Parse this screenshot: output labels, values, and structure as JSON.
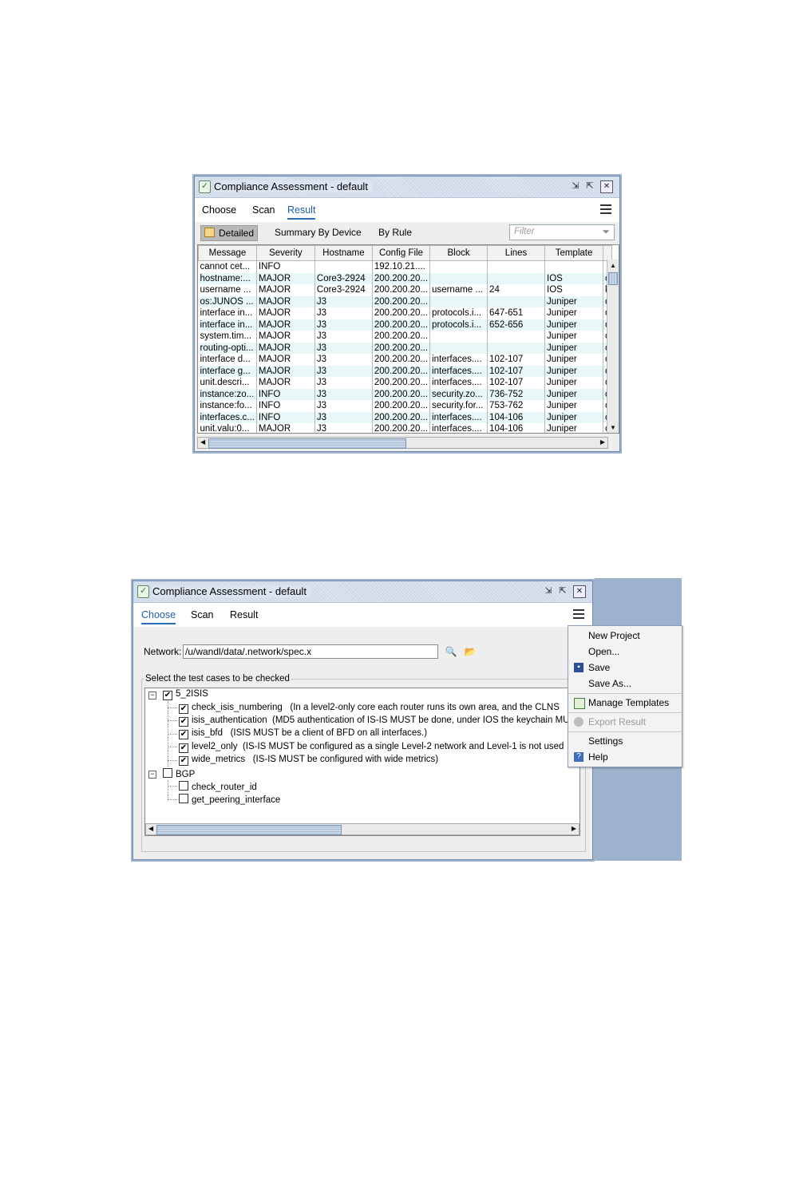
{
  "window1": {
    "title": "Compliance Assessment - default",
    "tabs": [
      "Choose",
      "Scan",
      "Result"
    ],
    "active_tab": "Result",
    "views": {
      "detailed": "Detailed",
      "by_device": "Summary By Device",
      "by_rule": "By Rule"
    },
    "filter_placeholder": "Filter",
    "columns": [
      "Message",
      "Severity",
      "Hostname",
      "Config File",
      "Block",
      "Lines",
      "Template"
    ],
    "rows": [
      [
        "cannot cet...",
        "INFO",
        "",
        "192.10.21....",
        "",
        "",
        "",
        ""
      ],
      [
        "hostname:...",
        "MAJOR",
        "Core3-2924",
        "200.200.20...",
        "",
        "",
        "IOS",
        "c"
      ],
      [
        "username ...",
        "MAJOR",
        "Core3-2924",
        "200.200.20...",
        "username ...",
        "24",
        "IOS",
        "k"
      ],
      [
        "os:JUNOS ...",
        "MAJOR",
        "J3",
        "200.200.20...",
        "",
        "",
        "Juniper",
        "c"
      ],
      [
        "interface in...",
        "MAJOR",
        "J3",
        "200.200.20...",
        "protocols.i...",
        "647-651",
        "Juniper",
        "c"
      ],
      [
        "interface in...",
        "MAJOR",
        "J3",
        "200.200.20...",
        "protocols.i...",
        "652-656",
        "Juniper",
        "c"
      ],
      [
        "system.tim...",
        "MAJOR",
        "J3",
        "200.200.20...",
        "",
        "",
        "Juniper",
        "c"
      ],
      [
        "routing-opti...",
        "MAJOR",
        "J3",
        "200.200.20...",
        "",
        "",
        "Juniper",
        "c"
      ],
      [
        "interface d...",
        "MAJOR",
        "J3",
        "200.200.20...",
        "interfaces....",
        "102-107",
        "Juniper",
        "c"
      ],
      [
        "interface g...",
        "MAJOR",
        "J3",
        "200.200.20...",
        "interfaces....",
        "102-107",
        "Juniper",
        "c"
      ],
      [
        "unit.descri...",
        "MAJOR",
        "J3",
        "200.200.20...",
        "interfaces....",
        "102-107",
        "Juniper",
        "c"
      ],
      [
        "instance:zo...",
        "INFO",
        "J3",
        "200.200.20...",
        "security.zo...",
        "736-752",
        "Juniper",
        "c"
      ],
      [
        "instance:fo...",
        "INFO",
        "J3",
        "200.200.20...",
        "security.for...",
        "753-762",
        "Juniper",
        "c"
      ],
      [
        "interfaces.c...",
        "INFO",
        "J3",
        "200.200.20...",
        "interfaces....",
        "104-106",
        "Juniper",
        "c"
      ],
      [
        "unit.valu:0...",
        "MAJOR",
        "J3",
        "200.200.20...",
        "interfaces....",
        "104-106",
        "Juniper",
        "c"
      ]
    ]
  },
  "window2": {
    "title": "Compliance Assessment - default",
    "tabs": [
      "Choose",
      "Scan",
      "Result"
    ],
    "active_tab": "Choose",
    "network_label": "Network:",
    "network_value": "/u/wandl/data/.network/spec.x",
    "group_label": "Select the test cases to be checked",
    "tree": {
      "groups": [
        {
          "label": "5_2ISIS",
          "checked": true,
          "items": [
            {
              "name": "check_isis_numbering",
              "desc": "(In a level2-only core each router runs its own area, and the CLNS",
              "checked": true
            },
            {
              "name": "isis_authentication",
              "desc": "(MD5 authentication of IS-IS MUST be done, under IOS the keychain MU",
              "checked": true
            },
            {
              "name": "isis_bfd",
              "desc": "(ISIS MUST be a client of BFD on all interfaces.)",
              "checked": true
            },
            {
              "name": "level2_only",
              "desc": "(IS-IS MUST be configured as a single Level-2 network and Level-1 is not used",
              "checked": true
            },
            {
              "name": "wide_metrics",
              "desc": "(IS-IS MUST be configured with wide metrics)",
              "checked": true
            }
          ]
        },
        {
          "label": "BGP",
          "checked": false,
          "items": [
            {
              "name": "check_router_id",
              "desc": "",
              "checked": false
            },
            {
              "name": "get_peering_interface",
              "desc": "",
              "checked": false
            }
          ]
        }
      ]
    },
    "menu": {
      "new_project": "New Project",
      "open": "Open...",
      "save": "Save",
      "save_as": "Save As...",
      "manage_templates": "Manage Templates",
      "export_result": "Export Result",
      "settings": "Settings",
      "help": "Help"
    }
  },
  "colors": {
    "accent": "#2a6db9",
    "row_alt": "#e8f8f8",
    "side_panel": "#9db2cc"
  }
}
